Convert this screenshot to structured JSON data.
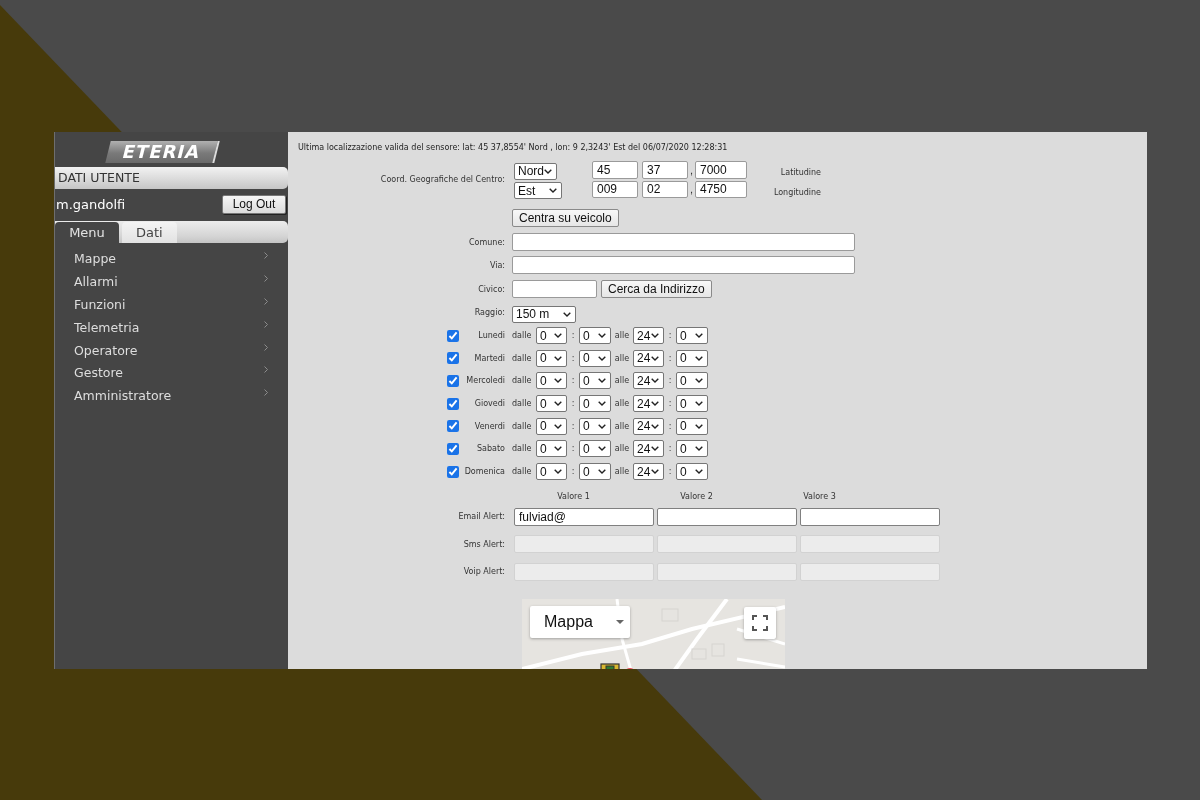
{
  "sidebar": {
    "logo": "ETERIA",
    "user_panel": {
      "title": "DATI UTENTE",
      "username": "m.gandolfi",
      "logout_button": "Log Out"
    },
    "tabs": [
      {
        "label": "Menu",
        "selected": true
      },
      {
        "label": "Dati",
        "selected": false
      }
    ],
    "menu_items": [
      {
        "label": "Mappe"
      },
      {
        "label": "Allarmi"
      },
      {
        "label": "Funzioni"
      },
      {
        "label": "Telemetria"
      },
      {
        "label": "Operatore"
      },
      {
        "label": "Gestore"
      },
      {
        "label": "Amministratore"
      }
    ]
  },
  "main": {
    "last_location": "Ultima localizzazione valida del sensore: lat: 45 37,8554' Nord , lon: 9 2,3243' Est del 06/07/2020 12:28:31",
    "coordinates": {
      "label": "Coord. Geografiche del Centro:",
      "rows": [
        {
          "hemisphere": "Nord",
          "degrees": "45",
          "minutes": "37",
          "separator": ",",
          "fraction": "7000",
          "caption": "Latitudine"
        },
        {
          "hemisphere": "Est",
          "degrees": "009",
          "minutes": "02",
          "separator": ",",
          "fraction": "4750",
          "caption": "Longitudine"
        }
      ],
      "center_button": "Centra su veicolo"
    },
    "address": {
      "comune_label": "Comune:",
      "via_label": "Via:",
      "civico_label": "Civico:",
      "search_button": "Cerca da Indirizzo"
    },
    "radius": {
      "label": "Raggio:",
      "value": "150 m"
    },
    "schedule": [
      {
        "day": "Lunedi",
        "checked": true,
        "from_label": "dalle",
        "from_hour": "0",
        "from_separator": ":",
        "from_minute": "0",
        "to_label": "alle",
        "to_hour": "24",
        "to_separator": ":",
        "to_minute": "0"
      },
      {
        "day": "Martedi",
        "checked": true,
        "from_label": "dalle",
        "from_hour": "0",
        "from_separator": ":",
        "from_minute": "0",
        "to_label": "alle",
        "to_hour": "24",
        "to_separator": ":",
        "to_minute": "0"
      },
      {
        "day": "Mercoledi",
        "checked": true,
        "from_label": "dalle",
        "from_hour": "0",
        "from_separator": ":",
        "from_minute": "0",
        "to_label": "alle",
        "to_hour": "24",
        "to_separator": ":",
        "to_minute": "0"
      },
      {
        "day": "Giovedi",
        "checked": true,
        "from_label": "dalle",
        "from_hour": "0",
        "from_separator": ":",
        "from_minute": "0",
        "to_label": "alle",
        "to_hour": "24",
        "to_separator": ":",
        "to_minute": "0"
      },
      {
        "day": "Venerdi",
        "checked": true,
        "from_label": "dalle",
        "from_hour": "0",
        "from_separator": ":",
        "from_minute": "0",
        "to_label": "alle",
        "to_hour": "24",
        "to_separator": ":",
        "to_minute": "0"
      },
      {
        "day": "Sabato",
        "checked": true,
        "from_label": "dalle",
        "from_hour": "0",
        "from_separator": ":",
        "from_minute": "0",
        "to_label": "alle",
        "to_hour": "24",
        "to_separator": ":",
        "to_minute": "0"
      },
      {
        "day": "Domenica",
        "checked": true,
        "from_label": "dalle",
        "from_hour": "0",
        "from_separator": ":",
        "from_minute": "0",
        "to_label": "alle",
        "to_hour": "24",
        "to_separator": ":",
        "to_minute": "0"
      }
    ],
    "alerts": {
      "columns": [
        "Valore 1",
        "Valore 2",
        "Valore 3"
      ],
      "rows": [
        {
          "label": "Email Alert:",
          "fields": [
            {
              "value": "fulviad@",
              "disabled": false
            },
            {
              "disabled": false
            },
            {
              "disabled": false
            }
          ]
        },
        {
          "label": "Sms Alert:",
          "fields": [
            {
              "disabled": true
            },
            {
              "disabled": true
            },
            {
              "disabled": true
            }
          ]
        },
        {
          "label": "Voip Alert:",
          "fields": [
            {
              "disabled": true
            },
            {
              "disabled": true
            },
            {
              "disabled": true
            }
          ]
        }
      ]
    },
    "map": {
      "type_button": "Mappa"
    }
  }
}
